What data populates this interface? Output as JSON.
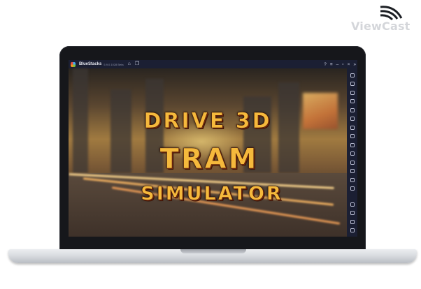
{
  "watermark": {
    "text": "ViewCast",
    "icon": "wifi-signal-icon"
  },
  "emulator": {
    "app_name": "BlueStacks",
    "version_text": "5.9.0.1028 Beta",
    "titlebar_icons": [
      "home-icon",
      "multi-instance-icon"
    ],
    "window_controls": [
      "help-icon",
      "menu-icon",
      "minimize-icon",
      "maximize-icon",
      "close-icon",
      "collapse-sidebar-icon"
    ],
    "sidebar_icons": [
      "fullscreen-icon",
      "volume-up-icon",
      "volume-down-icon",
      "screen-record-icon",
      "screenshot-icon",
      "rotate-icon",
      "shake-icon",
      "keyboard-controls-icon",
      "gamepad-icon",
      "apk-install-icon",
      "folder-icon",
      "macro-icon",
      "eco-mode-icon",
      "location-icon",
      "settings-icon",
      "back-icon",
      "home-icon",
      "recent-apps-icon"
    ]
  },
  "game": {
    "title_line1": "DRIVE 3D",
    "title_line2": "TRAM",
    "title_line3": "SIMULATOR"
  },
  "colors": {
    "title_fill": "#f5b93c",
    "title_outline": "#4a1a08",
    "window_chrome": "#1b1f33",
    "laptop_bezel": "#16171b"
  }
}
